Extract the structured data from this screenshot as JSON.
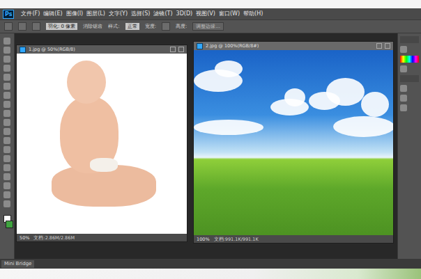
{
  "app": {
    "logo": "Ps"
  },
  "menu": [
    "文件(F)",
    "编辑(E)",
    "图像(I)",
    "图层(L)",
    "文字(Y)",
    "选择(S)",
    "滤镜(T)",
    "3D(D)",
    "视图(V)",
    "窗口(W)",
    "帮助(H)"
  ],
  "options": {
    "feather": "羽化: 0 像素",
    "antialias": "消除锯齿",
    "style_label": "样式:",
    "style_value": "正常",
    "width_label": "宽度:",
    "height_label": "高度:",
    "refine": "调整边缘..."
  },
  "documents": [
    {
      "title": "1.jpg @ 50%(RGB/8)",
      "zoom": "50%",
      "info": "文档:2.86M/2.86M",
      "selected": false,
      "kind": "baby"
    },
    {
      "title": "2.jpg @ 100%(RGB/8#)",
      "zoom": "100%",
      "info": "文档:991.1K/991.1K",
      "selected": true,
      "kind": "landscape"
    }
  ],
  "bottom_tab": "Mini Bridge"
}
